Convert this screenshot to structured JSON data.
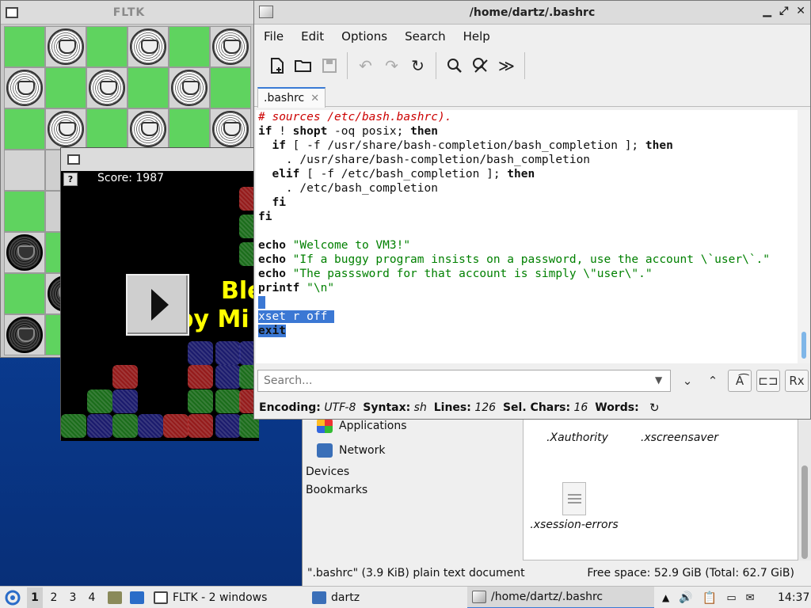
{
  "fltk_window": {
    "title": "FLTK",
    "board": [
      [
        "g",
        "pw",
        "g",
        "pw",
        "g",
        "pw"
      ],
      [
        "pw",
        "g",
        "pw",
        "g",
        "pw",
        "g"
      ],
      [
        "g",
        "pw",
        "g",
        "pw",
        "g",
        "pw"
      ],
      [
        "l",
        "w",
        "l",
        "w",
        "l",
        "w"
      ],
      [
        "g",
        "w",
        "g",
        "w",
        "g",
        "w"
      ],
      [
        "pd",
        "g",
        "w",
        "g",
        "w",
        "g"
      ],
      [
        "g",
        "pd",
        "g",
        "w",
        "g",
        "w"
      ],
      [
        "pd",
        "g",
        "w",
        "g",
        "w",
        "g"
      ]
    ]
  },
  "game_window": {
    "help_label": "?",
    "score_text": "Score: 1987",
    "text_line1": "Ble",
    "text_line2": "by Mi"
  },
  "file_manager": {
    "places": [
      {
        "label": "Applications",
        "icon": "applications-icon"
      },
      {
        "label": "Network",
        "icon": "network-icon"
      }
    ],
    "sections": [
      "Devices",
      "Bookmarks"
    ],
    "files": [
      ".Xauthority",
      ".xscreensaver",
      ".xsession-errors"
    ],
    "status_left": "\".bashrc\" (3.9 KiB) plain text document",
    "status_right": "Free space: 52.9 GiB (Total: 62.7 GiB)"
  },
  "editor": {
    "title": "/home/dartz/.bashrc",
    "menus": [
      "File",
      "Edit",
      "Options",
      "Search",
      "Help"
    ],
    "tab_label": ".bashrc",
    "search_placeholder": "Search...",
    "status": {
      "encoding_label": "Encoding:",
      "encoding": "UTF-8",
      "syntax_label": "Syntax:",
      "syntax": "sh",
      "lines_label": "Lines:",
      "lines": "126",
      "selchars_label": "Sel. Chars:",
      "selchars": "16",
      "words_label": "Words:"
    }
  },
  "taskbar": {
    "workspaces": [
      "1",
      "2",
      "3",
      "4"
    ],
    "tasks": [
      "FLTK - 2 windows",
      "dartz",
      "/home/dartz/.bashrc"
    ],
    "clock": "14:37"
  }
}
